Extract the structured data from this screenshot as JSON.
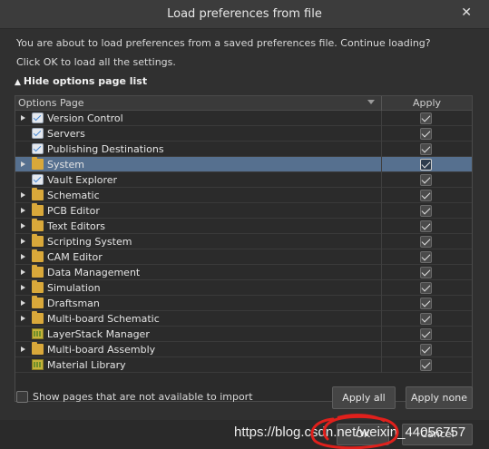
{
  "window": {
    "title": "Load preferences from file",
    "close_glyph": "✕"
  },
  "message": {
    "line1": "You are about to load preferences from a saved preferences file. Continue loading?",
    "line2": "Click OK to load all the settings."
  },
  "toggle": {
    "label": "Hide options page list",
    "glyph": "▲"
  },
  "table": {
    "header_name": "Options Page",
    "header_apply": "Apply",
    "rows": [
      {
        "label": "Version Control",
        "icon": "checklist-icon",
        "expandable": true,
        "checked": true,
        "selected": false
      },
      {
        "label": "Servers",
        "icon": "checklist-icon",
        "expandable": false,
        "checked": true,
        "selected": false
      },
      {
        "label": "Publishing Destinations",
        "icon": "checklist-icon",
        "expandable": false,
        "checked": true,
        "selected": false
      },
      {
        "label": "System",
        "icon": "folder-icon",
        "expandable": true,
        "checked": true,
        "selected": true
      },
      {
        "label": "Vault Explorer",
        "icon": "checklist-icon",
        "expandable": false,
        "checked": true,
        "selected": false
      },
      {
        "label": "Schematic",
        "icon": "folder-icon",
        "expandable": true,
        "checked": true,
        "selected": false
      },
      {
        "label": "PCB Editor",
        "icon": "folder-icon",
        "expandable": true,
        "checked": true,
        "selected": false
      },
      {
        "label": "Text Editors",
        "icon": "folder-icon",
        "expandable": true,
        "checked": true,
        "selected": false
      },
      {
        "label": "Scripting System",
        "icon": "folder-icon",
        "expandable": true,
        "checked": true,
        "selected": false
      },
      {
        "label": "CAM Editor",
        "icon": "folder-icon",
        "expandable": true,
        "checked": true,
        "selected": false
      },
      {
        "label": "Data Management",
        "icon": "folder-icon",
        "expandable": true,
        "checked": true,
        "selected": false
      },
      {
        "label": "Simulation",
        "icon": "folder-icon",
        "expandable": true,
        "checked": true,
        "selected": false
      },
      {
        "label": "Draftsman",
        "icon": "folder-icon",
        "expandable": true,
        "checked": true,
        "selected": false
      },
      {
        "label": "Multi-board Schematic",
        "icon": "folder-icon",
        "expandable": true,
        "checked": true,
        "selected": false
      },
      {
        "label": "LayerStack Manager",
        "icon": "board-icon",
        "expandable": false,
        "checked": true,
        "selected": false
      },
      {
        "label": "Multi-board Assembly",
        "icon": "folder-icon",
        "expandable": true,
        "checked": true,
        "selected": false
      },
      {
        "label": "Material Library",
        "icon": "board-icon",
        "expandable": false,
        "checked": true,
        "selected": false
      }
    ]
  },
  "show_unavailable": {
    "label": "Show pages that are not available to import",
    "checked": false
  },
  "buttons": {
    "apply_all": "Apply all",
    "apply_none": "Apply none",
    "ok": "OK",
    "cancel": "Cancel"
  },
  "watermark": "https://blog.csdn.net/weixin_44056757",
  "colors": {
    "selection": "#56708f",
    "folder": "#d9a83a",
    "annotation": "#e0201c"
  }
}
